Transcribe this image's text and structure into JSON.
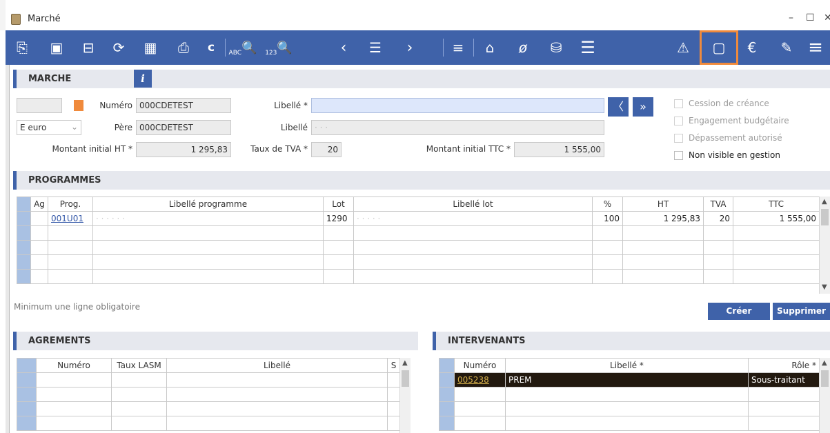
{
  "window": {
    "title": "Marché",
    "minimize": "–",
    "maximize": "☐",
    "close": "✕"
  },
  "toolbar": {
    "new_icon": "⎘",
    "save_icon": "▣",
    "delete_icon": "⊟",
    "refresh_icon": "⟳",
    "calendar_icon": "▦",
    "print_icon": "⎙",
    "copy_label": "c",
    "search_abc_icon": "🔍",
    "search_abc_sub": "ABC",
    "search_123_icon": "🔍",
    "search_123_sub": "123",
    "prev_icon": "‹",
    "list_icon": "☰",
    "next_icon": "›",
    "filter_icon": "≡",
    "home_icon": "⌂",
    "link_icon": "ø",
    "coins_icon": "⛁",
    "menu_list_icon": "☰",
    "warning_icon": "⚠",
    "history_icon": "▢",
    "euro_label": "€",
    "edit_icon": "✎",
    "menu_icon": "≡"
  },
  "marche": {
    "header": "MARCHE",
    "info_label": "i",
    "numero_label": "Numéro",
    "numero_value": "000CDETEST",
    "pere_label": "Père",
    "pere_value": "000CDETEST",
    "devise_value": "E euro",
    "devise_arrow": "⌄",
    "libelle_req_label": "Libellé *",
    "libelle_label": "Libellé",
    "libelle2_value": "· · ·",
    "montant_ht_label": "Montant initial HT *",
    "montant_ht_value": "1 295,83",
    "tva_label": "Taux de TVA *",
    "tva_value": "20",
    "montant_ttc_label": "Montant initial TTC *",
    "montant_ttc_value": "1 555,00",
    "nav_prev": "〈",
    "nav_next": "»",
    "checks": [
      "Cession de créance",
      "Engagement budgétaire",
      "Dépassement autorisé",
      "Non visible en gestion"
    ]
  },
  "programmes": {
    "header": "PROGRAMMES",
    "columns": [
      "Ag",
      "Prog.",
      "Libellé programme",
      "Lot",
      "Libellé lot",
      "%",
      "HT",
      "TVA",
      "TTC"
    ],
    "rows": [
      {
        "prog": "001U01",
        "libelle_prog": "· · · · · ·",
        "lot": "1290",
        "libelle_lot": "· · · · ·",
        "pct": "100",
        "ht": "1 295,83",
        "tva": "20",
        "ttc": "1 555,00"
      }
    ],
    "hint": "Minimum une ligne obligatoire",
    "create_label": "Créer",
    "delete_label": "Supprimer"
  },
  "agrements": {
    "header": "AGREMENTS",
    "columns": [
      "Numéro",
      "Taux LASM",
      "Libellé",
      "S"
    ]
  },
  "intervenants": {
    "header": "INTERVENANTS",
    "columns": [
      "Numéro",
      "Libellé *",
      "Rôle *"
    ],
    "rows": [
      {
        "numero": "005238",
        "libelle": "PREM",
        "role": "Sous-traitant"
      }
    ]
  },
  "colors": {
    "toolbar": "#3f62a9",
    "accent_orange": "#f08a3c",
    "selected_row": "#22190f"
  }
}
